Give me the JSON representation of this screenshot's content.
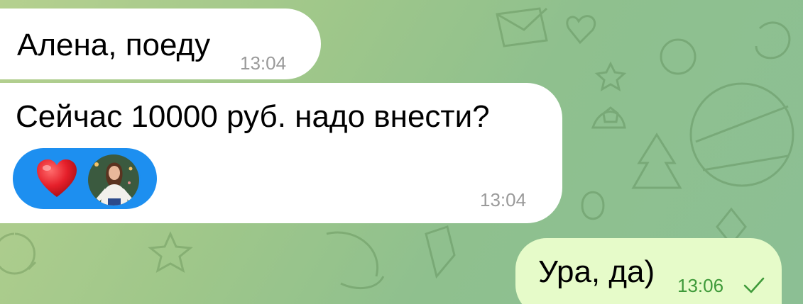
{
  "messages": [
    {
      "direction": "incoming",
      "text": "Алена, поеду",
      "time": "13:04"
    },
    {
      "direction": "incoming",
      "text": "Сейчас 10000 руб. надо внести?",
      "time": "13:04",
      "reaction": {
        "emoji_icon": "heart-icon",
        "emoji_color": "#e51f2a",
        "background": "#1d8ff0"
      }
    },
    {
      "direction": "outgoing",
      "text": "Ура, да)",
      "time": "13:06",
      "status_icon": "check-icon"
    }
  ],
  "colors": {
    "incoming_bubble": "#ffffff",
    "outgoing_bubble": "#e6fbc9",
    "incoming_time": "#9a9a9a",
    "outgoing_time": "#3f9a3a",
    "wallpaper": "#9fc78a"
  }
}
